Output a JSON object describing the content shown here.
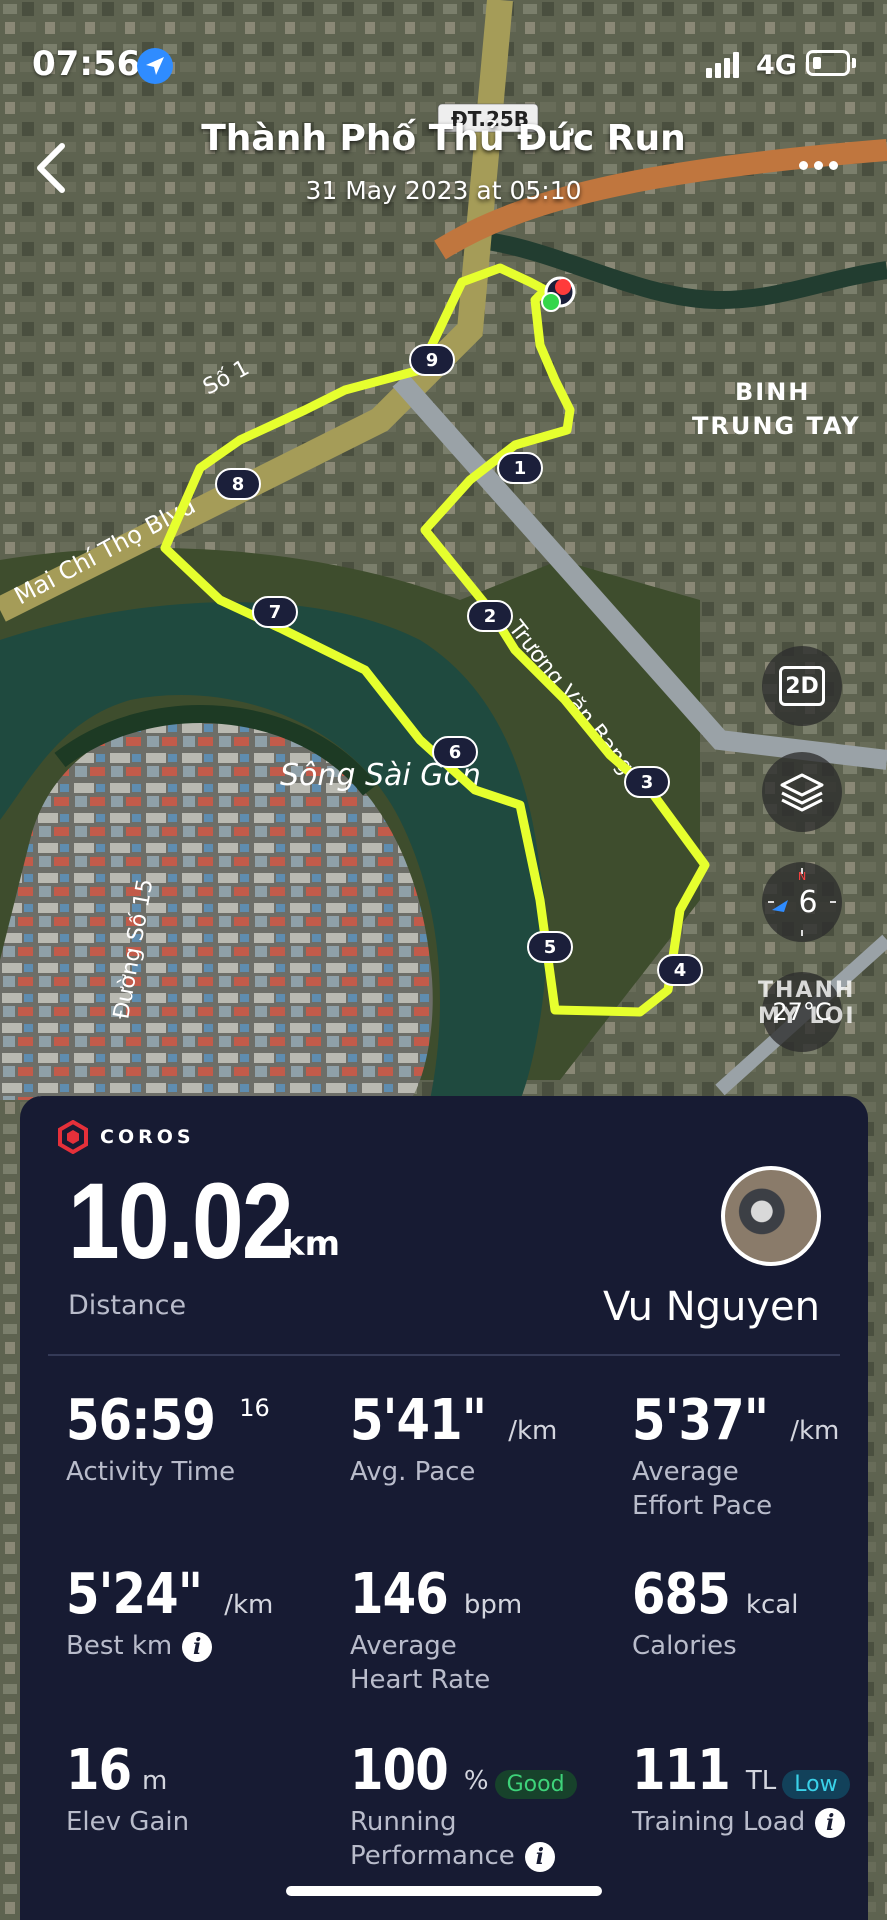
{
  "status_bar": {
    "time": "07:56",
    "network": "4G",
    "icons": [
      "location-arrow-icon",
      "signal-icon",
      "battery-icon"
    ]
  },
  "header": {
    "title": "Thành Phố Thủ Đức Run",
    "subtitle": "31 May 2023 at 05:10"
  },
  "map": {
    "labels": {
      "road_badge": "ĐT.25B",
      "district": "BINH\nTRUNG TAY",
      "so1": "Số 1",
      "mct_blvd": "Mai Chí Thọ Blvd",
      "river": "Sông Sài Gòn",
      "street": "Trương Văn Bang",
      "duong15": "Đường Số 15",
      "thanh_my_loi": "THANH\nMY LOI"
    },
    "route_color": "#e6ff2e",
    "km_markers": [
      "1",
      "2",
      "3",
      "4",
      "5",
      "6",
      "7",
      "8",
      "9"
    ],
    "controls": {
      "view_mode": "2D",
      "compass_value": "6",
      "temperature": "27°C"
    }
  },
  "card": {
    "brand": "COROS",
    "distance": {
      "value": "10.02",
      "unit": "km",
      "label": "Distance"
    },
    "user_name": "Vu Nguyen",
    "stats": {
      "activity_time": {
        "value": "56:59",
        "sup": "16",
        "label": "Activity Time"
      },
      "avg_pace": {
        "value": "5'41\"",
        "unit": "/km",
        "label": "Avg. Pace"
      },
      "effort_pace": {
        "value": "5'37\"",
        "unit": "/km",
        "label_1": "Average",
        "label_2": "Effort Pace"
      },
      "best_km": {
        "value": "5'24\"",
        "unit": "/km",
        "label": "Best km"
      },
      "heart_rate": {
        "value": "146",
        "unit": "bpm",
        "label_1": "Average",
        "label_2": "Heart Rate"
      },
      "calories": {
        "value": "685",
        "unit": "kcal",
        "label": "Calories"
      },
      "elev_gain": {
        "value": "16",
        "unit": "m",
        "label": "Elev Gain"
      },
      "running_perf": {
        "value": "100",
        "unit": "%",
        "badge": "Good",
        "label_1": "Running",
        "label_2": "Performance"
      },
      "training_load": {
        "value": "111",
        "unit": "TL",
        "badge": "Low",
        "label": "Training Load"
      }
    }
  }
}
